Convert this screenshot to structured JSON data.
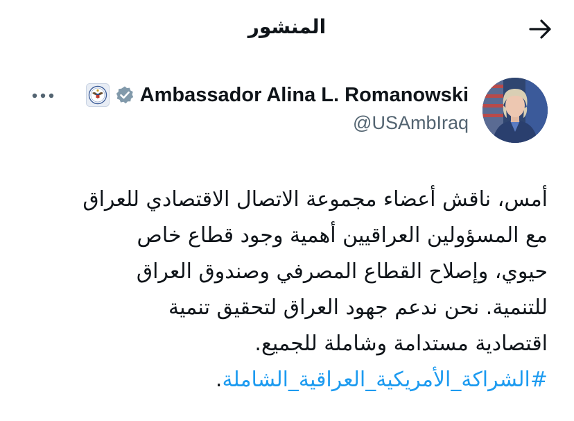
{
  "header": {
    "title": "المنشور",
    "back_icon": "arrow-right-icon"
  },
  "author": {
    "name": "Ambassador Alina L. Romanowski",
    "handle": "@USAmbIraq",
    "verified": true,
    "verified_color": "#829aab",
    "affiliation_icon": "us-state-department-seal-icon"
  },
  "tweet": {
    "lines": [
      "أمس، ناقش أعضاء مجموعة الاتصال الاقتصادي للعراق",
      "مع المسؤولين العراقيين أهمية وجود قطاع خاص",
      "حيوي، وإصلاح القطاع المصرفي وصندوق العراق",
      "للتنمية. نحن ندعم جهود العراق لتحقيق تنمية",
      "اقتصادية مستدامة وشاملة للجميع."
    ],
    "hashtag": "#الشراكة_الأمريكية_العراقية_الشاملة",
    "hashtag_suffix": ".",
    "hashtag_color": "#1d9bf0"
  },
  "colors": {
    "text": "#0f1419",
    "secondary": "#536471"
  }
}
